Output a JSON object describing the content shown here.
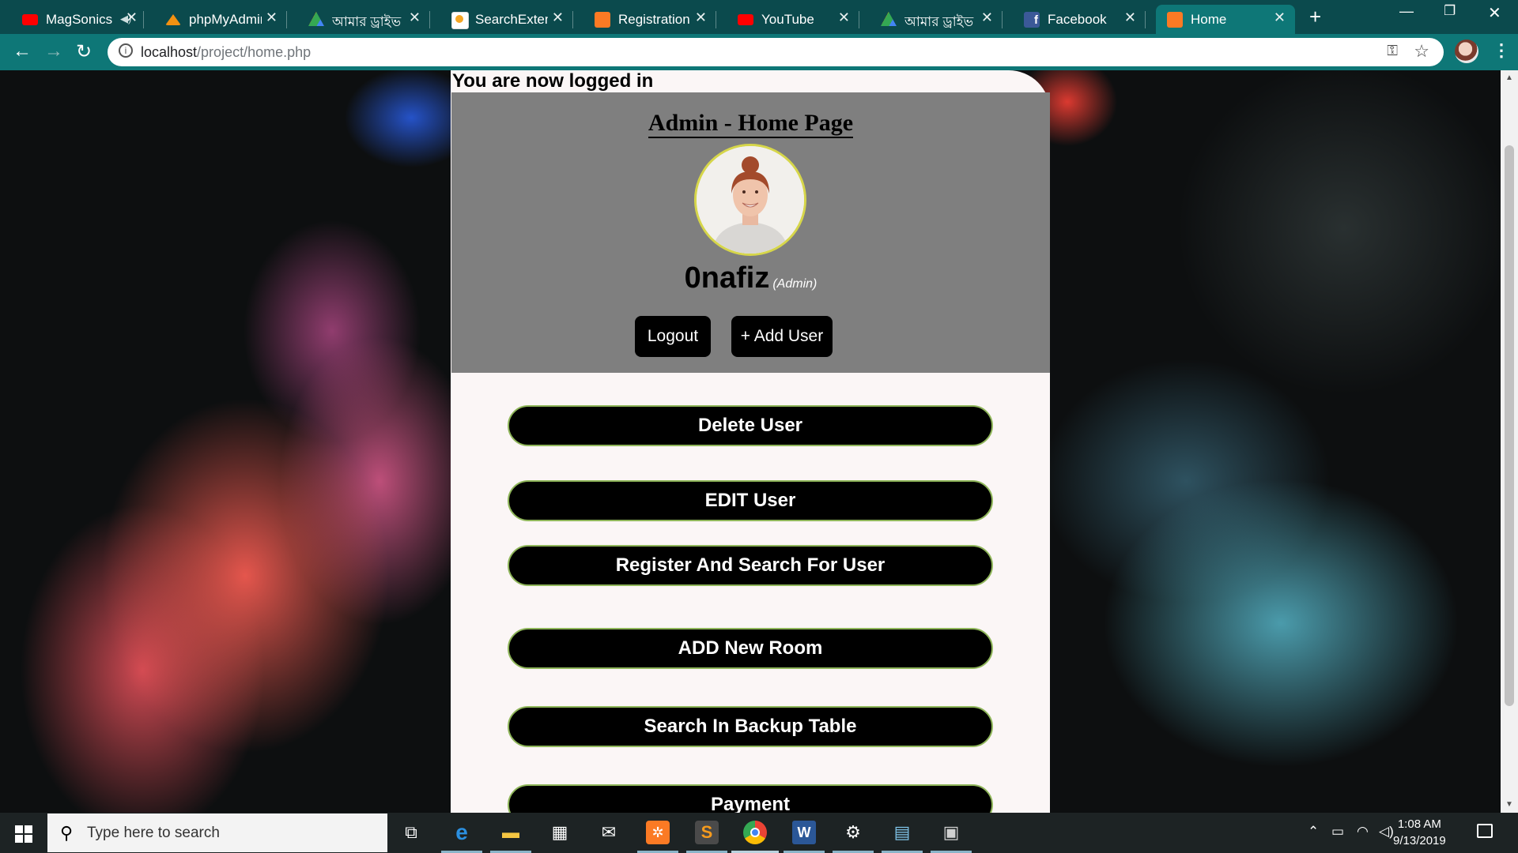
{
  "browser": {
    "tabs": [
      {
        "title": "MagSonics",
        "favicon": "youtube-icon",
        "color": "#ff0000"
      },
      {
        "title": "phpMyAdmin",
        "favicon": "phpmyadmin-icon",
        "color": "#f29111"
      },
      {
        "title": "আমার ড্রাইভ - Google Drive",
        "favicon": "google-drive-icon",
        "color": "#34a853"
      },
      {
        "title": "SearchExtension",
        "favicon": "extension-icon",
        "color": "#f5a623"
      },
      {
        "title": "Registration",
        "favicon": "xampp-icon",
        "color": "#fb7a24"
      },
      {
        "title": "YouTube",
        "favicon": "youtube-icon",
        "color": "#ff0000"
      },
      {
        "title": "আমার ড্রাইভ - Google Drive",
        "favicon": "google-drive-icon",
        "color": "#34a853"
      },
      {
        "title": "Facebook",
        "favicon": "facebook-icon",
        "color": "#3b5998"
      },
      {
        "title": "Home",
        "favicon": "xampp-icon",
        "color": "#fb7a24",
        "active": true
      }
    ],
    "address": {
      "host": "localhost",
      "path": "/project/home.php"
    }
  },
  "page": {
    "status_text": "You are now logged in",
    "title": "Admin - Home Page",
    "username": "0nafiz",
    "role": "(Admin)",
    "logout_label": "Logout",
    "add_user_label": "+ Add User",
    "actions": [
      "Delete User",
      "EDIT User",
      "Register And Search For User",
      "ADD New Room",
      "Search In Backup Table",
      "Payment"
    ]
  },
  "taskbar": {
    "search_placeholder": "Type here to search",
    "time": "1:08 AM",
    "date": "9/13/2019"
  },
  "colors": {
    "tab_strip": "#0b4a4d",
    "toolbar": "#0e7777",
    "header_panel": "#7f7f7f",
    "button_border": "#8fb65a"
  }
}
